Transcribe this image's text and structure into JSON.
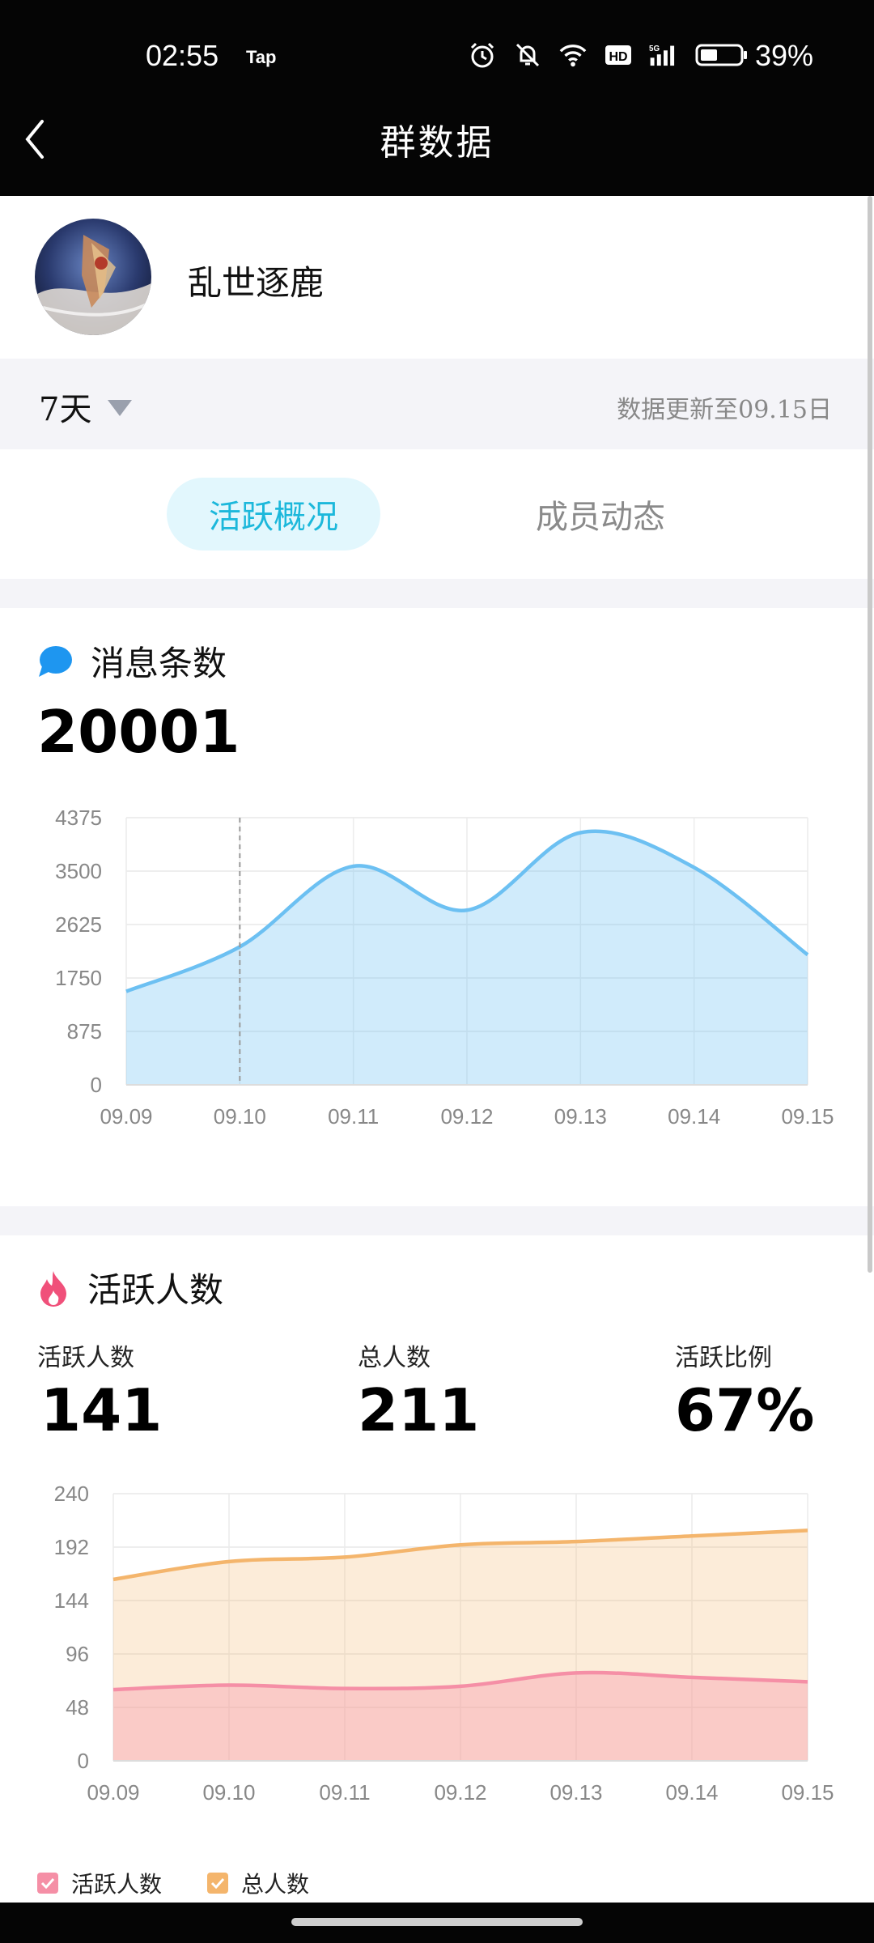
{
  "status_bar": {
    "time": "02:55",
    "carrier_tag": "Tap",
    "battery": "39%",
    "icons": [
      "alarm-icon",
      "mute-icon",
      "wifi-icon",
      "hd-icon",
      "5g-signal-icon",
      "battery-icon"
    ]
  },
  "header": {
    "title": "群数据",
    "back_icon": "chevron-left-icon"
  },
  "group": {
    "name": "乱世逐鹿"
  },
  "filter": {
    "range": "7天",
    "updated": "数据更新至09.15日"
  },
  "tabs": [
    {
      "label": "活跃概况",
      "active": true
    },
    {
      "label": "成员动态",
      "active": false
    }
  ],
  "messages": {
    "title": "消息条数",
    "total": "20001",
    "icon": "chat-bubble-icon",
    "color": "#1e96f0"
  },
  "active": {
    "title": "活跃人数",
    "icon": "flame-icon",
    "color": "#f0507a",
    "stats": [
      {
        "label": "活跃人数",
        "value": "141"
      },
      {
        "label": "总人数",
        "value": "211"
      },
      {
        "label": "活跃比例",
        "value": "67%"
      }
    ],
    "legend": [
      {
        "label": "活跃人数",
        "color": "#f58fa6"
      },
      {
        "label": "总人数",
        "color": "#f4b56c"
      }
    ]
  },
  "chart_data": [
    {
      "type": "area",
      "title": "",
      "categories": [
        "09.09",
        "09.10",
        "09.11",
        "09.12",
        "09.13",
        "09.14",
        "09.15"
      ],
      "yticks": [
        "4375",
        "3500",
        "2625",
        "1750",
        "875",
        "0"
      ],
      "ylim": [
        0,
        4375
      ],
      "grid": true,
      "series": [
        {
          "values": [
            1530,
            2260,
            3580,
            2860,
            4130,
            3560,
            2130
          ],
          "color": "#6cc0f2"
        }
      ]
    },
    {
      "type": "area",
      "title": "",
      "categories": [
        "09.09",
        "09.10",
        "09.11",
        "09.12",
        "09.13",
        "09.14",
        "09.15"
      ],
      "yticks": [
        "240",
        "192",
        "144",
        "96",
        "48",
        "0"
      ],
      "ylim": [
        0,
        240
      ],
      "grid": true,
      "legend": "bottom-left",
      "series": [
        {
          "name": "总人数",
          "values": [
            163,
            179,
            183,
            194,
            197,
            202,
            207
          ],
          "color": "#f4b56c"
        },
        {
          "name": "活跃人数",
          "values": [
            64,
            68,
            65,
            67,
            79,
            75,
            71
          ],
          "color": "#f58fa6"
        }
      ]
    }
  ]
}
